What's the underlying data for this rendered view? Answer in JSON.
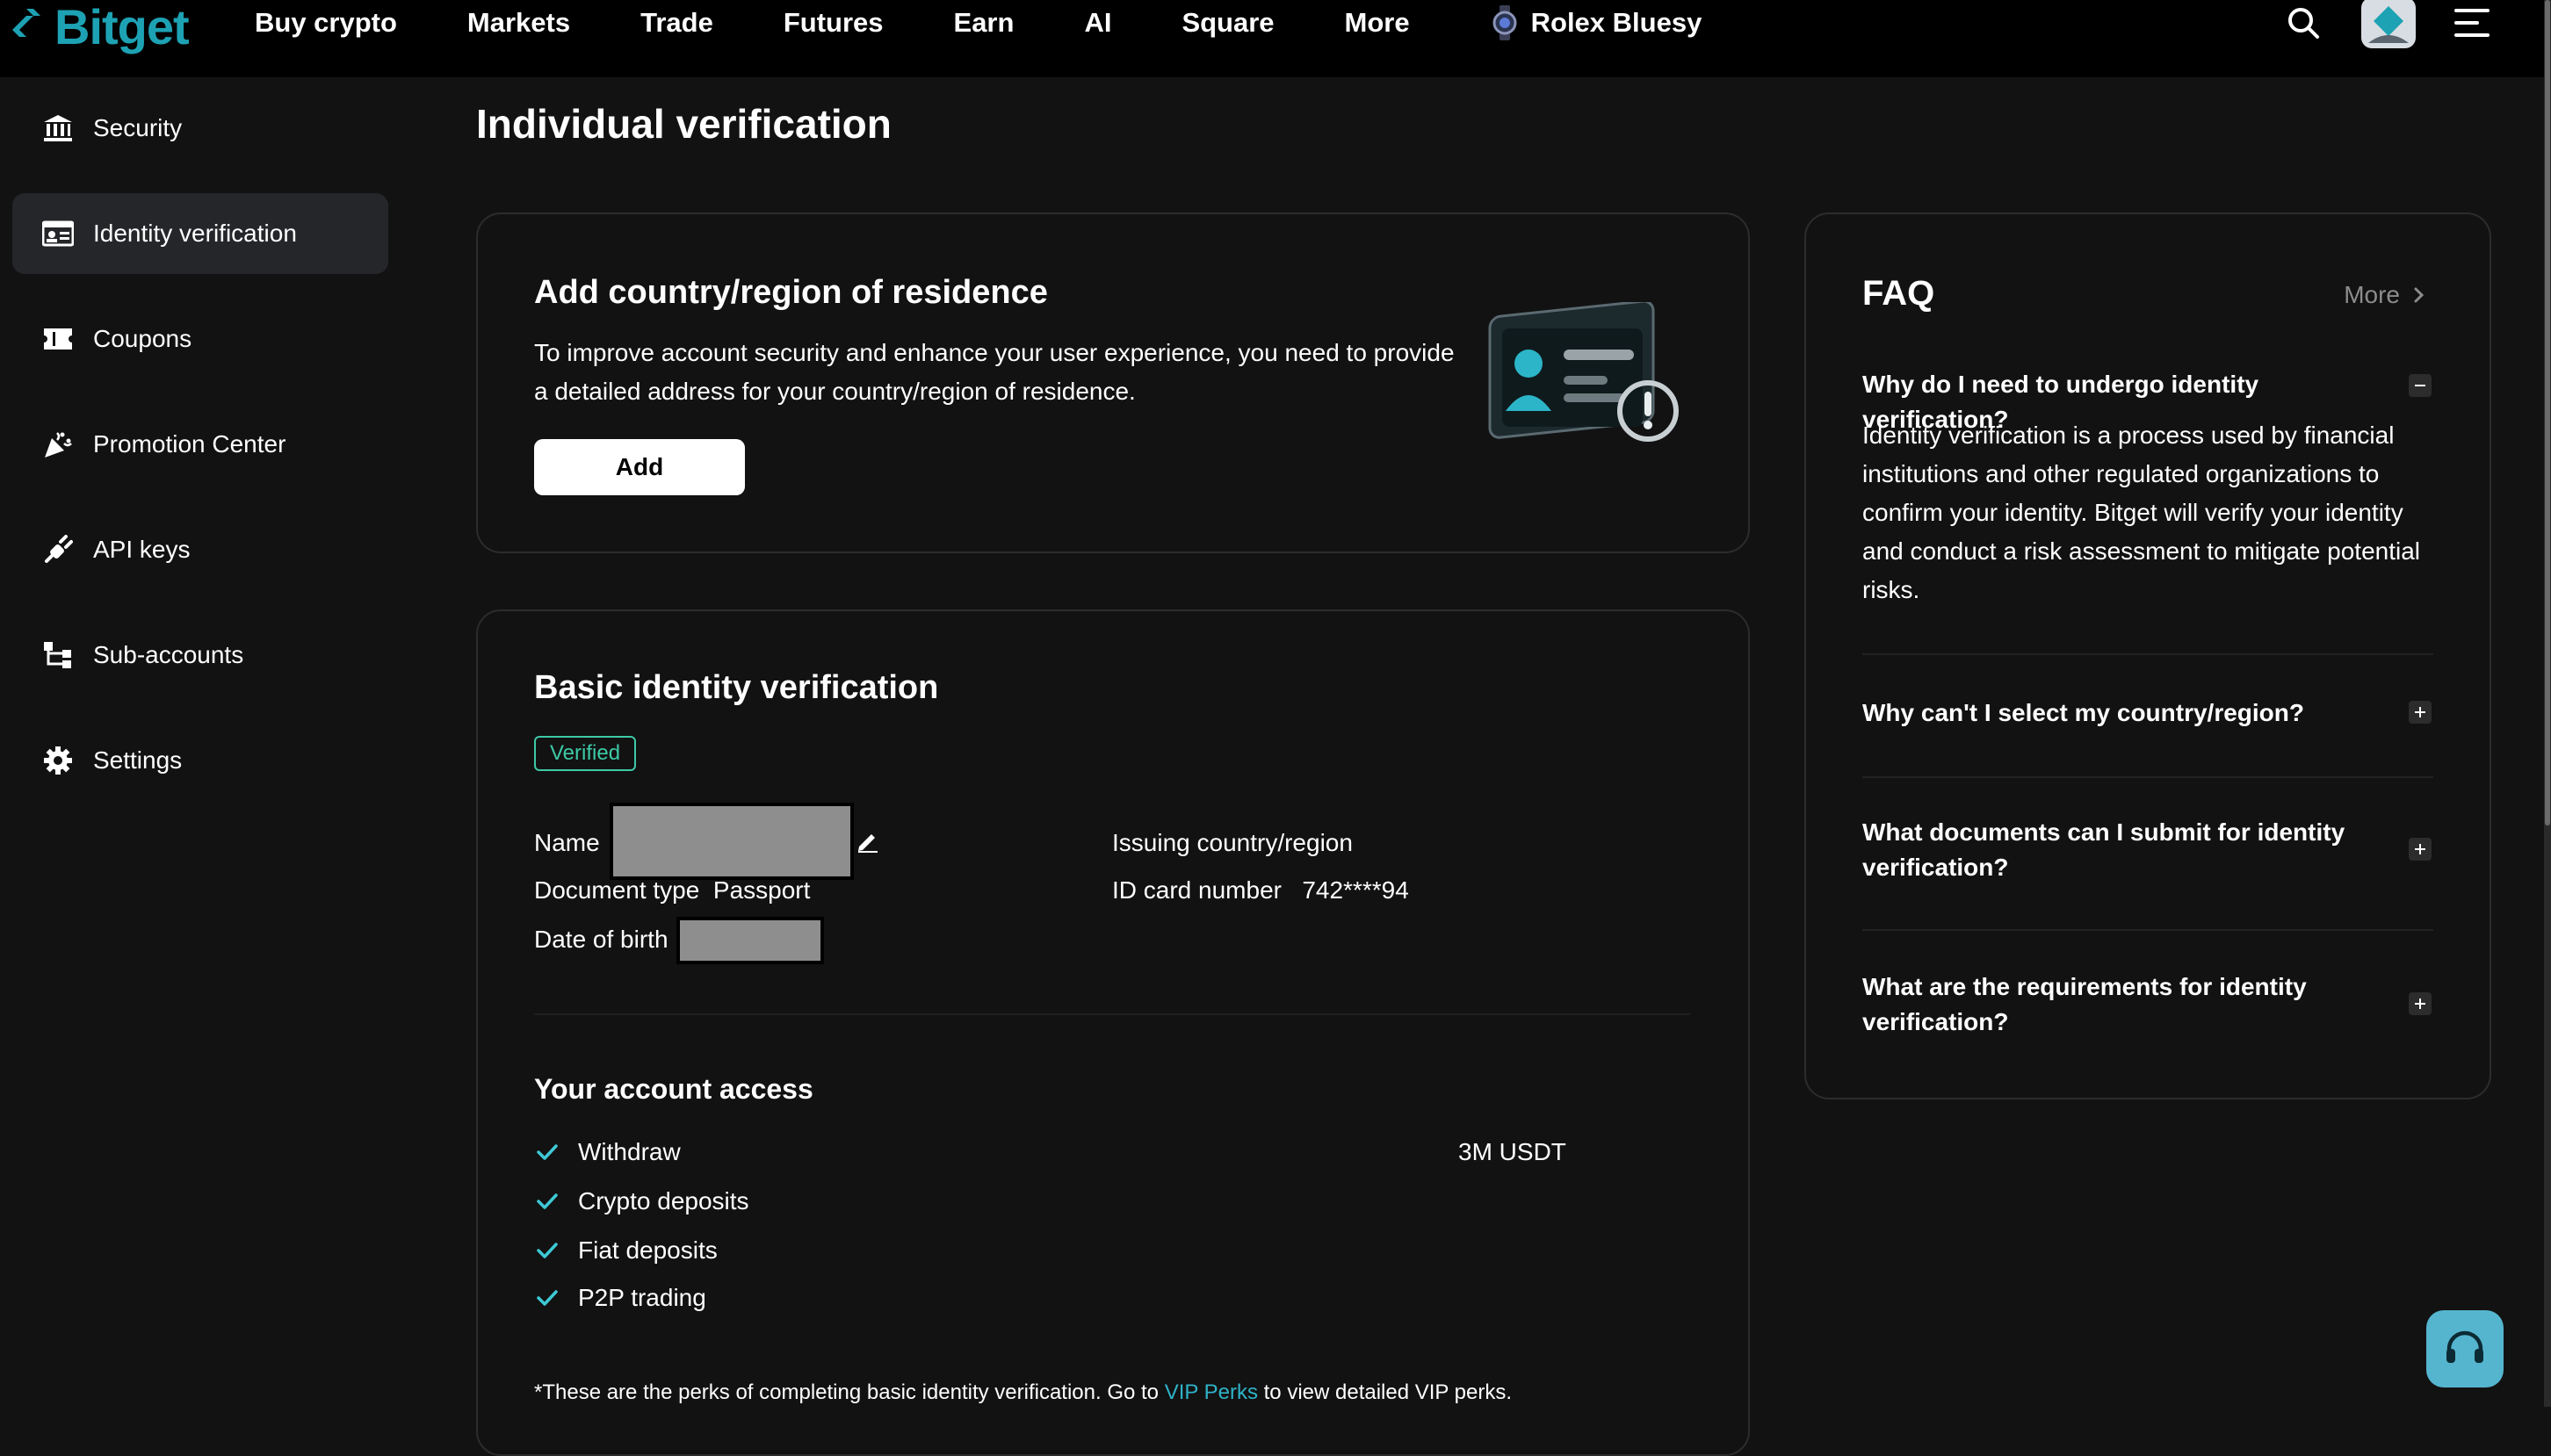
{
  "brand": {
    "name": "Bitget",
    "color": "#1da2b4"
  },
  "nav": {
    "items": [
      "Buy crypto",
      "Markets",
      "Trade",
      "Futures",
      "Earn",
      "AI",
      "Square",
      "More"
    ],
    "promo_label": "Rolex Bluesy"
  },
  "sidebar": {
    "items": [
      {
        "label": "Security",
        "icon": "bank-icon"
      },
      {
        "label": "Identity verification",
        "icon": "id-card-icon",
        "active": true
      },
      {
        "label": "Coupons",
        "icon": "ticket-icon"
      },
      {
        "label": "Promotion Center",
        "icon": "party-popper-icon"
      },
      {
        "label": "API keys",
        "icon": "plug-icon"
      },
      {
        "label": "Sub-accounts",
        "icon": "hierarchy-icon"
      },
      {
        "label": "Settings",
        "icon": "gear-icon"
      }
    ]
  },
  "main": {
    "title": "Individual verification",
    "residence": {
      "title": "Add country/region of residence",
      "description_1": "To improve account security and enhance your user experience, you need to provide",
      "description_2": "a detailed address for your country/region of residence.",
      "add_label": "Add"
    },
    "basic": {
      "title": "Basic identity verification",
      "status": "Verified",
      "name_label": "Name",
      "document_type_label": "Document type",
      "document_type_value": "Passport",
      "dob_label": "Date of birth",
      "issuing_label": "Issuing country/region",
      "id_number_label": "ID card number",
      "id_number_value": "742****94"
    },
    "access": {
      "title": "Your account access",
      "items": [
        "Withdraw",
        "Crypto deposits",
        "Fiat deposits",
        "P2P trading"
      ],
      "withdraw_limit": "3M USDT",
      "note_prefix": "*These are the perks of completing basic identity verification. Go to ",
      "note_link": "VIP Perks",
      "note_suffix": " to view detailed VIP perks."
    }
  },
  "faq": {
    "title": "FAQ",
    "more_label": "More",
    "items": [
      {
        "question": "Why do I need to undergo identity verification?",
        "expanded": true,
        "answer": "Identity verification is a process used by financial institutions and other regulated organizations to confirm your identity. Bitget will verify your identity and conduct a risk assessment to mitigate potential risks."
      },
      {
        "question": "Why can't I select my country/region?",
        "expanded": false
      },
      {
        "question": "What documents can I submit for identity verification?",
        "expanded": false
      },
      {
        "question": "What are the requirements for identity verification?",
        "expanded": false
      }
    ]
  },
  "colors": {
    "verified": "#3ec9a6",
    "link": "#2fb3c8",
    "support_button": "#55b5cf"
  }
}
